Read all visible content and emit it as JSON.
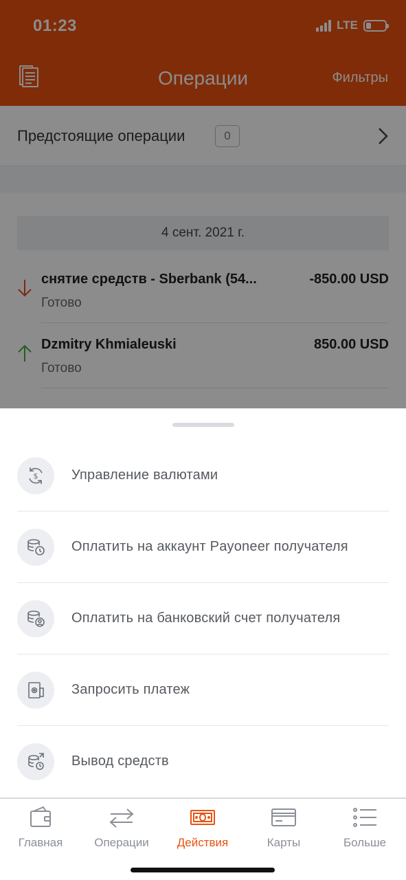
{
  "status_bar": {
    "time": "01:23",
    "network": "LTE",
    "battery_level": 0.25
  },
  "nav": {
    "title": "Операции",
    "filter_label": "Фильтры"
  },
  "upcoming": {
    "label": "Предстоящие операции",
    "count": "0"
  },
  "transactions": {
    "date": "4 сент. 2021 г.",
    "items": [
      {
        "name": "снятие средств - Sberbank (54...",
        "amount": "-850.00 USD",
        "status": "Готово",
        "direction": "down",
        "color": "#e04a2b"
      },
      {
        "name": "Dzmitry Khmialeuski",
        "amount": "850.00 USD",
        "status": "Готово",
        "direction": "up",
        "color": "#3fae3f"
      }
    ]
  },
  "actions": [
    {
      "label": "Управление валютами",
      "icon": "currency-exchange-icon"
    },
    {
      "label": "Оплатить на аккаунт Payoneer получателя",
      "icon": "coins-clock-icon"
    },
    {
      "label": "Оплатить на банковский счет получателя",
      "icon": "coins-user-icon"
    },
    {
      "label": "Запросить платеж",
      "icon": "request-payment-icon"
    },
    {
      "label": "Вывод средств",
      "icon": "coins-withdraw-icon"
    }
  ],
  "tabbar": {
    "tabs": [
      {
        "label": "Главная",
        "icon": "wallet-icon",
        "active": false
      },
      {
        "label": "Операции",
        "icon": "transfer-arrows-icon",
        "active": false
      },
      {
        "label": "Действия",
        "icon": "banknote-icon",
        "active": true
      },
      {
        "label": "Карты",
        "icon": "card-icon",
        "active": false
      },
      {
        "label": "Больше",
        "icon": "more-list-icon",
        "active": false
      }
    ]
  },
  "colors": {
    "brand": "#e9510f",
    "inactive": "#8a8f97"
  }
}
